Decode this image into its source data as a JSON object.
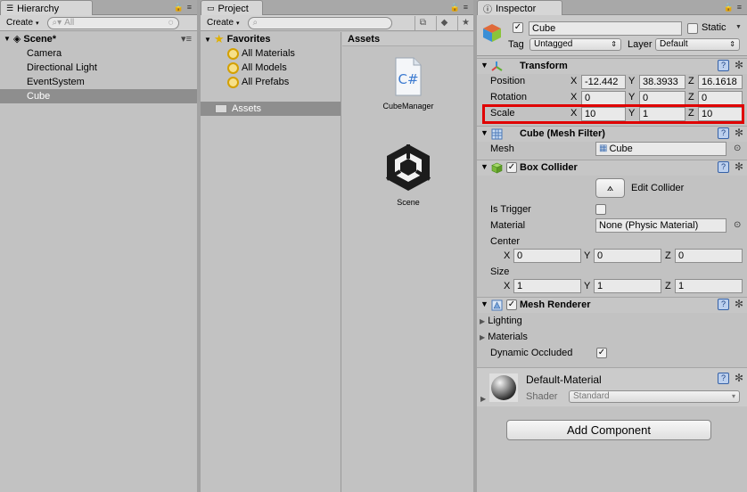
{
  "hierarchy": {
    "tab_label": "Hierarchy",
    "create_label": "Create",
    "search_placeholder": "All",
    "scene_name": "Scene*",
    "items": [
      {
        "label": "Camera"
      },
      {
        "label": "Directional Light"
      },
      {
        "label": "EventSystem"
      },
      {
        "label": "Cube"
      }
    ]
  },
  "project": {
    "tab_label": "Project",
    "create_label": "Create",
    "favorites_label": "Favorites",
    "favorites": [
      {
        "label": "All Materials"
      },
      {
        "label": "All Models"
      },
      {
        "label": "All Prefabs"
      }
    ],
    "assets_folder_label": "Assets",
    "assets_header": "Assets",
    "assets": [
      {
        "label": "CubeManager",
        "icon": "csharp-script-icon"
      },
      {
        "label": "Scene",
        "icon": "unity-scene-icon"
      }
    ]
  },
  "inspector": {
    "tab_label": "Inspector",
    "object_name": "Cube",
    "static_label": "Static",
    "tag_label": "Tag",
    "tag_value": "Untagged",
    "layer_label": "Layer",
    "layer_value": "Default",
    "transform": {
      "title": "Transform",
      "position_label": "Position",
      "rotation_label": "Rotation",
      "scale_label": "Scale",
      "axis_x": "X",
      "axis_y": "Y",
      "axis_z": "Z",
      "position": {
        "x": "-12.442",
        "y": "38.3933",
        "z": "16.1618"
      },
      "rotation": {
        "x": "0",
        "y": "0",
        "z": "0"
      },
      "scale": {
        "x": "10",
        "y": "1",
        "z": "10"
      }
    },
    "mesh_filter": {
      "title": "Cube (Mesh Filter)",
      "mesh_label": "Mesh",
      "mesh_value": "Cube"
    },
    "box_collider": {
      "title": "Box Collider",
      "edit_collider_label": "Edit Collider",
      "is_trigger_label": "Is Trigger",
      "material_label": "Material",
      "material_value": "None (Physic Material)",
      "center_label": "Center",
      "center": {
        "x": "0",
        "y": "0",
        "z": "0"
      },
      "size_label": "Size",
      "size": {
        "x": "1",
        "y": "1",
        "z": "1"
      }
    },
    "mesh_renderer": {
      "title": "Mesh Renderer",
      "lighting_label": "Lighting",
      "materials_label": "Materials",
      "dynamic_occluded_label": "Dynamic Occluded"
    },
    "material": {
      "name": "Default-Material",
      "shader_label": "Shader",
      "shader_value": "Standard"
    },
    "add_component_label": "Add Component"
  },
  "colors": {
    "highlight": "#e00000",
    "selection": "#8e8e8e",
    "panel_bg": "#c2c2c2"
  }
}
